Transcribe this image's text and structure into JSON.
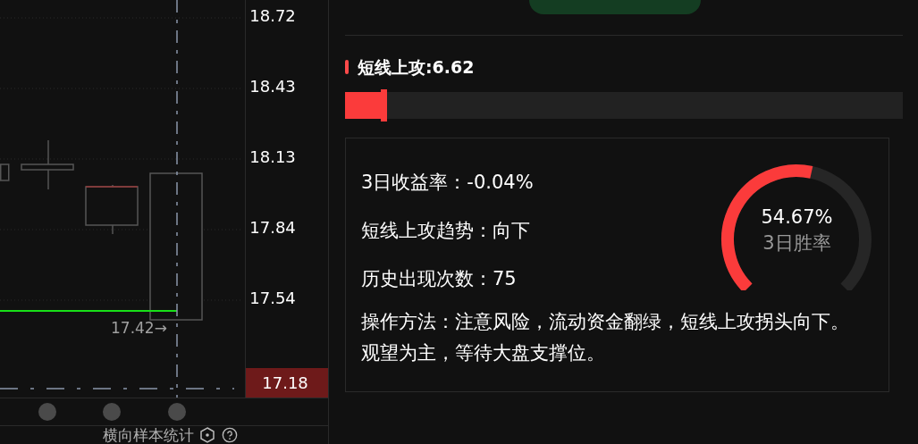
{
  "chart": {
    "price_axis": [
      "18.72",
      "18.43",
      "18.13",
      "17.84",
      "17.54"
    ],
    "current_price": "17.18",
    "marker_label": "17.42→",
    "footer_label": "横向样本统计"
  },
  "indicator": {
    "title": "短线上攻:6.62",
    "level": 0.07,
    "stats": [
      "3日收益率：-0.04%",
      "短线上攻趋势：向下",
      "历史出现次数：75"
    ],
    "method": "操作方法：注意风险，流动资金翻绿，短线上攻拐头向下。观望为主，等待大盘支撑位。",
    "gauge": {
      "value": "54.67%",
      "label": "3日胜率"
    }
  }
}
